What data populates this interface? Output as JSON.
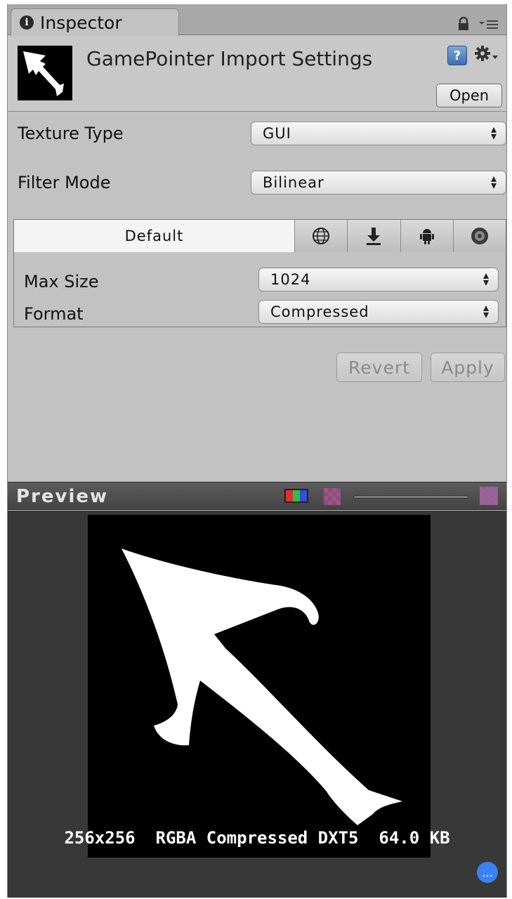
{
  "tab": {
    "label": "Inspector"
  },
  "header": {
    "title": "GamePointer Import Settings",
    "open_label": "Open",
    "help_glyph": "?"
  },
  "properties": {
    "texture_type": {
      "label": "Texture Type",
      "value": "GUI"
    },
    "filter_mode": {
      "label": "Filter Mode",
      "value": "Bilinear"
    }
  },
  "platform": {
    "default_tab": "Default",
    "icons": [
      "globe-icon",
      "download-icon",
      "android-icon",
      "disc-icon"
    ],
    "max_size": {
      "label": "Max Size",
      "value": "1024"
    },
    "format": {
      "label": "Format",
      "value": "Compressed"
    }
  },
  "actions": {
    "revert_label": "Revert",
    "apply_label": "Apply"
  },
  "preview": {
    "title": "Preview",
    "info": "256x256  RGBA Compressed DXT5  64.0 KB",
    "chat_glyph": "..."
  },
  "colors": {
    "panel_bg": "#c2c2c2",
    "preview_bg": "#383838",
    "accent": "#3b82f6"
  }
}
